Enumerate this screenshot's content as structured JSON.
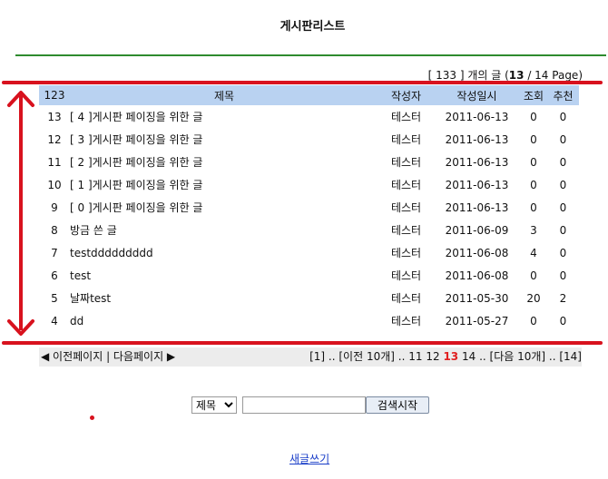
{
  "page_title": "게시판리스트",
  "summary": {
    "open": "[",
    "total": "133",
    "mid": "] 개의 글 (",
    "current": "13",
    "sep": " / ",
    "pages": "14",
    "close": " Page)"
  },
  "columns": {
    "num": "123",
    "title": "제목",
    "author": "작성자",
    "date": "작성일시",
    "views": "조회",
    "rec": "추천"
  },
  "rows": [
    {
      "num": "13",
      "title": "[ 4 ]게시판 페이징을 위한 글",
      "author": "테스터",
      "date": "2011-06-13",
      "views": "0",
      "rec": "0"
    },
    {
      "num": "12",
      "title": "[ 3 ]게시판 페이징을 위한 글",
      "author": "테스터",
      "date": "2011-06-13",
      "views": "0",
      "rec": "0"
    },
    {
      "num": "11",
      "title": "[ 2 ]게시판 페이징을 위한 글",
      "author": "테스터",
      "date": "2011-06-13",
      "views": "0",
      "rec": "0"
    },
    {
      "num": "10",
      "title": "[ 1 ]게시판 페이징을 위한 글",
      "author": "테스터",
      "date": "2011-06-13",
      "views": "0",
      "rec": "0"
    },
    {
      "num": "9",
      "title": "[ 0 ]게시판 페이징을 위한 글",
      "author": "테스터",
      "date": "2011-06-13",
      "views": "0",
      "rec": "0"
    },
    {
      "num": "8",
      "title": "방금 쓴 글",
      "author": "테스터",
      "date": "2011-06-09",
      "views": "3",
      "rec": "0"
    },
    {
      "num": "7",
      "title": "testddddddddd",
      "author": "테스터",
      "date": "2011-06-08",
      "views": "4",
      "rec": "0"
    },
    {
      "num": "6",
      "title": "test",
      "author": "테스터",
      "date": "2011-06-08",
      "views": "0",
      "rec": "0"
    },
    {
      "num": "5",
      "title": "날짜test",
      "author": "테스터",
      "date": "2011-05-30",
      "views": "20",
      "rec": "2"
    },
    {
      "num": "4",
      "title": "dd",
      "author": "테스터",
      "date": "2011-05-27",
      "views": "0",
      "rec": "0"
    }
  ],
  "pager": {
    "prev_page": "◀ 이전페이지",
    "divider": " | ",
    "next_page": "다음페이지 ▶",
    "first": "[1]",
    "dots1": " .. ",
    "prev10": "[이전 10개]",
    "dots2": " .. ",
    "p11": "11",
    "p12": "12",
    "p13": "13",
    "p14": "14",
    "dots3": " .. ",
    "next10": "[다음 10개]",
    "dots4": " .. ",
    "last": "[14]"
  },
  "search": {
    "field": "제목",
    "query": "",
    "button": "검색시작"
  },
  "write_link": "새글쓰기",
  "colors": {
    "header_bg": "#b9d2f1",
    "annotation_red": "#d8121e",
    "title_rule_green": "#2e8b2e",
    "current_page": "#e02020",
    "link": "#1a3ec8"
  }
}
